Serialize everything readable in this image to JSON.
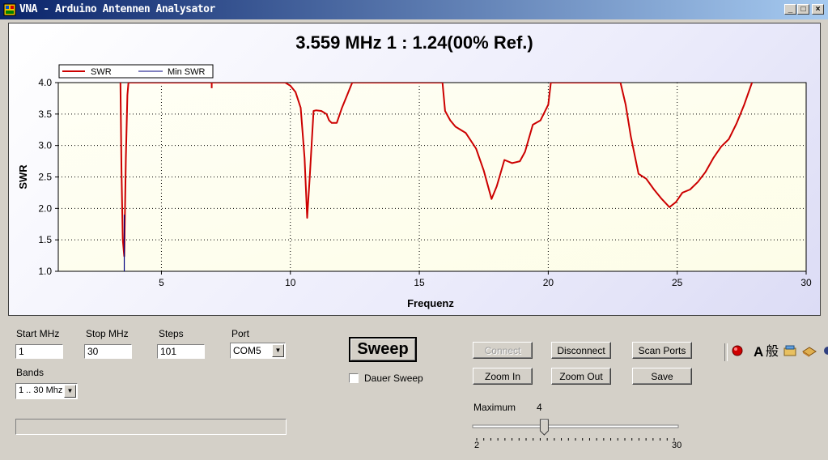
{
  "window": {
    "title": "VNA - Arduino Antennen Analysator",
    "minimize_glyph": "_",
    "maximize_glyph": "□",
    "close_glyph": "×"
  },
  "chart_title": "3.559 MHz   1 : 1.24(00% Ref.)",
  "chart_data": {
    "type": "line",
    "xlabel": "Frequenz",
    "ylabel": "SWR",
    "xlim": [
      1,
      30
    ],
    "ylim": [
      1.0,
      4.0
    ],
    "x_ticks": [
      5,
      10,
      15,
      20,
      25,
      30
    ],
    "x_tick_labels": [
      "5",
      "10",
      "15",
      "20",
      "25",
      "30"
    ],
    "y_ticks": [
      1.0,
      1.5,
      2.0,
      2.5,
      3.0,
      3.5,
      4.0
    ],
    "y_tick_labels": [
      "1.0",
      "1.5",
      "2.0",
      "2.5",
      "3.0",
      "3.5",
      "4.0"
    ],
    "grid": true,
    "legend": "top-left",
    "colors": {
      "swr": "#cc0000",
      "min_swr": "#000080",
      "plot_bg": "#fdfde8"
    },
    "series": [
      {
        "name": "SWR",
        "x": [
          3.41,
          3.45,
          3.5,
          3.559,
          3.62,
          3.68,
          3.72,
          3.76,
          9.8,
          10.0,
          10.2,
          10.4,
          10.55,
          10.65,
          10.75,
          10.9,
          11.0,
          11.2,
          11.4,
          11.5,
          11.6,
          11.8,
          12.0,
          12.2,
          12.3,
          12.4,
          15.9,
          16.0,
          16.2,
          16.4,
          16.8,
          17.2,
          17.5,
          17.8,
          18.0,
          18.3,
          18.6,
          18.9,
          19.1,
          19.4,
          19.7,
          20.0,
          20.1,
          22.8,
          23.0,
          23.2,
          23.5,
          23.8,
          24.1,
          24.4,
          24.7,
          24.95,
          25.2,
          25.5,
          25.8,
          26.1,
          26.4,
          26.7,
          27.0,
          27.3,
          27.6,
          27.9
        ],
        "y": [
          4.0,
          2.6,
          1.5,
          1.24,
          2.8,
          3.8,
          4.0,
          4.0,
          4.0,
          3.95,
          3.85,
          3.6,
          2.8,
          1.85,
          2.5,
          3.55,
          3.56,
          3.55,
          3.5,
          3.4,
          3.36,
          3.36,
          3.6,
          3.8,
          3.9,
          4.0,
          4.0,
          3.55,
          3.4,
          3.3,
          3.2,
          2.95,
          2.6,
          2.15,
          2.35,
          2.77,
          2.72,
          2.75,
          2.9,
          3.33,
          3.4,
          3.65,
          4.0,
          4.0,
          3.65,
          3.15,
          2.55,
          2.47,
          2.3,
          2.15,
          2.02,
          2.1,
          2.25,
          2.3,
          2.42,
          2.58,
          2.8,
          2.98,
          3.1,
          3.35,
          3.65,
          4.0
        ]
      },
      {
        "name": "Min SWR",
        "x": [
          3.559,
          3.559
        ],
        "y": [
          1.0,
          1.9
        ]
      }
    ],
    "marker": {
      "x": 6.95,
      "y": 3.95
    }
  },
  "controls": {
    "start_label": "Start MHz",
    "start_value": "1",
    "stop_label": "Stop MHz",
    "stop_value": "30",
    "steps_label": "Steps",
    "steps_value": "101",
    "port_label": "Port",
    "port_value": "COM5",
    "bands_label": "Bands",
    "bands_value": "1 .. 30 Mhz",
    "sweep_label": "Sweep",
    "dauer_sweep_label": "Dauer Sweep",
    "connect_label": "Connect",
    "disconnect_label": "Disconnect",
    "scan_ports_label": "Scan Ports",
    "zoom_in_label": "Zoom In",
    "zoom_out_label": "Zoom Out",
    "save_label": "Save",
    "maximum_label": "Maximum",
    "maximum_value": "4",
    "slider_min_label": "2",
    "slider_max_label": "30",
    "slider_min": 2,
    "slider_max": 30,
    "slider_value": 4,
    "progress_fraction": 0.0
  },
  "tray": {
    "icons": [
      "red-dot-icon",
      "ime-a-icon",
      "ime-kanji-icon",
      "ime-tool-icon",
      "ime-pad-icon"
    ],
    "ime_a_text": "A",
    "ime_kanji_text": "般"
  }
}
